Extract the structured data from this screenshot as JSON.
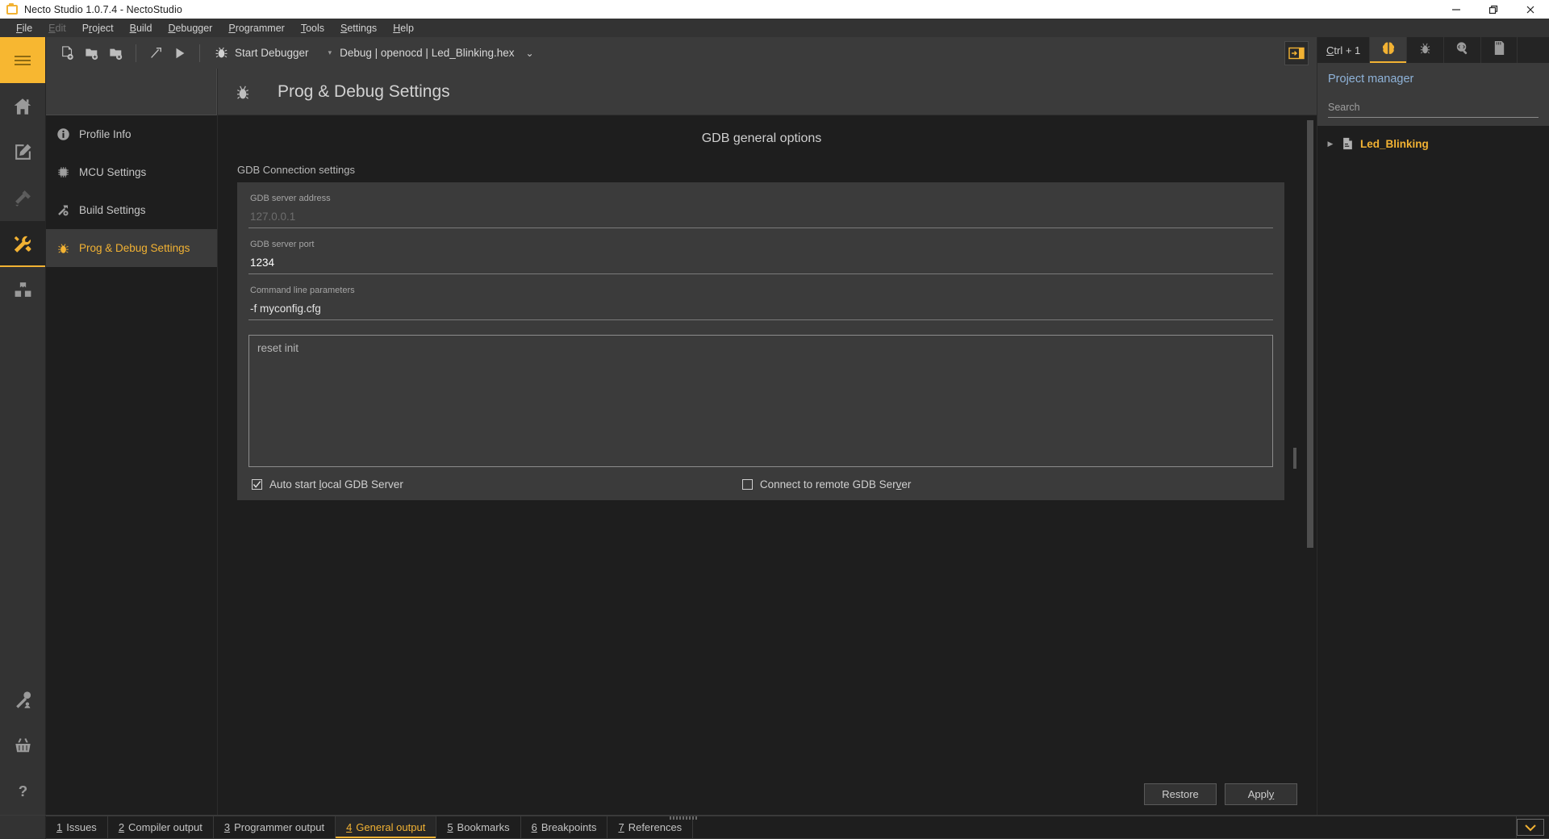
{
  "window": {
    "title": "Necto Studio 1.0.7.4 - NectoStudio",
    "app_icon": "folder-icon",
    "controls": {
      "minimize": "minimize-icon",
      "maximize": "maximize-icon",
      "close": "close-icon"
    },
    "accent_color": "#f2b233",
    "background_color": "#1e1e1e"
  },
  "menubar": {
    "items": [
      {
        "label": "File",
        "mnemonic": "F",
        "disabled": false
      },
      {
        "label": "Edit",
        "mnemonic": "E",
        "disabled": true
      },
      {
        "label": "Project",
        "mnemonic": "r",
        "disabled": false
      },
      {
        "label": "Build",
        "mnemonic": "B",
        "disabled": false
      },
      {
        "label": "Debugger",
        "mnemonic": "D",
        "disabled": false
      },
      {
        "label": "Programmer",
        "mnemonic": "P",
        "disabled": false
      },
      {
        "label": "Tools",
        "mnemonic": "T",
        "disabled": false
      },
      {
        "label": "Settings",
        "mnemonic": "S",
        "disabled": false
      },
      {
        "label": "Help",
        "mnemonic": "H",
        "disabled": false
      }
    ]
  },
  "rail": {
    "items": [
      {
        "name": "hamburger-menu-icon",
        "state": "accent"
      },
      {
        "name": "home-icon",
        "state": "normal"
      },
      {
        "name": "edit-icon",
        "state": "normal"
      },
      {
        "name": "design-tools-icon",
        "state": "dim"
      },
      {
        "name": "tools-icon",
        "state": "active"
      },
      {
        "name": "packages-icon",
        "state": "normal"
      },
      {
        "name": "license-key-icon",
        "state": "normal"
      },
      {
        "name": "shopping-basket-icon",
        "state": "normal"
      },
      {
        "name": "help-icon",
        "state": "normal"
      }
    ]
  },
  "toolbar": {
    "buttons": [
      {
        "name": "new-file-icon",
        "tooltip": "New File"
      },
      {
        "name": "open-project-icon",
        "tooltip": "Open Project"
      },
      {
        "name": "close-project-icon",
        "tooltip": "Close Project"
      },
      {
        "name": "build-hammer-icon",
        "tooltip": "Build"
      },
      {
        "name": "run-play-icon",
        "tooltip": "Run"
      }
    ],
    "start_debugger_label": "Start Debugger",
    "start_debugger_icon": "bug-icon",
    "config_caret": "▾",
    "config_text": "Debug | openocd | Led_Blinking.hex",
    "config_chevron": "⌄",
    "panel_toggle_icon": "toggle-right-panel-icon"
  },
  "nav": {
    "items": [
      {
        "label": "Profile Info",
        "icon": "info-icon",
        "active": false
      },
      {
        "label": "MCU Settings",
        "icon": "chip-icon",
        "active": false
      },
      {
        "label": "Build Settings",
        "icon": "hammer-gear-icon",
        "active": false
      },
      {
        "label": "Prog & Debug Settings",
        "icon": "bug-icon",
        "active": true
      }
    ]
  },
  "page": {
    "header_icon": "bug-icon",
    "header_title": "Prog & Debug Settings",
    "section_title": "GDB general options",
    "group_label": "GDB Connection settings",
    "fields": [
      {
        "label": "GDB server address",
        "value": "127.0.0.1",
        "is_placeholder": true
      },
      {
        "label": "GDB server port",
        "value": "1234",
        "is_placeholder": false
      },
      {
        "label": "Command line parameters",
        "value": "-f myconfig.cfg",
        "is_placeholder": false
      }
    ],
    "script_box": {
      "value": "reset init"
    },
    "checkboxes": [
      {
        "label": "Auto start local GDB Server",
        "mnemonic": "l",
        "checked": true
      },
      {
        "label": "Connect to remote GDB Server",
        "mnemonic": "v",
        "checked": false
      }
    ],
    "footer_buttons": [
      {
        "label": "Restore",
        "mnemonic": ""
      },
      {
        "label": "Apply",
        "mnemonic": "y"
      }
    ]
  },
  "right_panel": {
    "shortcut_hint": "Ctrl + 1",
    "shortcut_mnemonic": "C",
    "tabs": [
      {
        "name": "project-manager-icon",
        "active": true
      },
      {
        "name": "debug-bug-icon",
        "active": false
      },
      {
        "name": "code-search-icon",
        "active": false
      },
      {
        "name": "memory-card-icon",
        "active": false
      }
    ],
    "title": "Project manager",
    "search_placeholder": "Search",
    "tree": [
      {
        "label": "Led_Blinking",
        "icon": "project-file-icon",
        "expanded": false,
        "arrow": "▶"
      }
    ]
  },
  "bottom_tabs": {
    "items": [
      {
        "number": "1",
        "label": "Issues",
        "active": false
      },
      {
        "number": "2",
        "label": "Compiler output",
        "active": false
      },
      {
        "number": "3",
        "label": "Programmer output",
        "active": false
      },
      {
        "number": "4",
        "label": "General output",
        "active": true
      },
      {
        "number": "5",
        "label": "Bookmarks",
        "active": false
      },
      {
        "number": "6",
        "label": "Breakpoints",
        "active": false
      },
      {
        "number": "7",
        "label": "References",
        "active": false
      }
    ],
    "expand_icon": "chevron-down-icon"
  }
}
